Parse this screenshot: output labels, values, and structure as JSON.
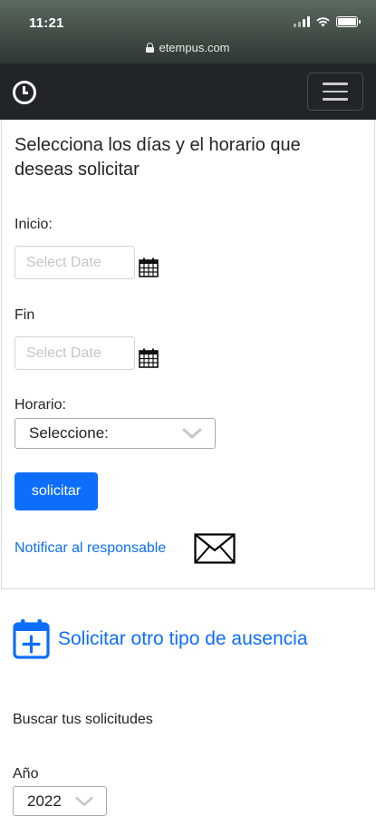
{
  "status_bar": {
    "time": "11:21",
    "url": "etempus.com",
    "icons": [
      "signal-icon",
      "wifi-icon",
      "battery-icon"
    ]
  },
  "navbar": {
    "brand_icon": "clock-icon",
    "menu_icon": "hamburger-icon",
    "background": "#212529"
  },
  "form": {
    "title": "Selecciona los días y el horario que deseas solicitar",
    "start_label": "Inicio:",
    "start_placeholder": "Select Date",
    "end_label": "Fin",
    "end_placeholder": "Select Date",
    "schedule_label": "Horario:",
    "schedule_value": "Seleccione:",
    "submit_label": "solicitar",
    "notify_label": "Notificar al responsable",
    "calendar_icon": "calendar-icon",
    "envelope_icon": "envelope-icon"
  },
  "other_absence": {
    "label": "Solicitar otro tipo de ausencia",
    "icon": "calendar-plus-icon"
  },
  "search": {
    "heading": "Buscar tus solicitudes",
    "year_label": "Año",
    "year_value": "2022"
  },
  "colors": {
    "primary": "#0d6efd",
    "navbar": "#212529"
  }
}
